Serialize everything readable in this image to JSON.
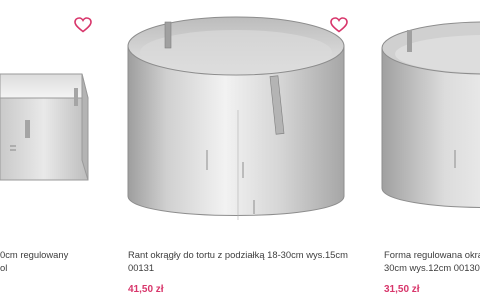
{
  "colors": {
    "accent": "#d8366b",
    "text": "#3d3d3d",
    "background": "#ffffff"
  },
  "products": [
    {
      "title_lines": [
        "0cm regulowany",
        "ol"
      ],
      "wishlist_icon": "heart-outline-icon"
    },
    {
      "title_lines": [
        "Rant okrągły do tortu z podziałką 18-30cm wys.15cm",
        "00131"
      ],
      "price": "41,50 zł",
      "wishlist_icon": "heart-outline-icon"
    },
    {
      "title_lines": [
        "Forma regulowana okrąg",
        "30cm wys.12cm 00130"
      ],
      "price": "31,50 zł"
    }
  ]
}
